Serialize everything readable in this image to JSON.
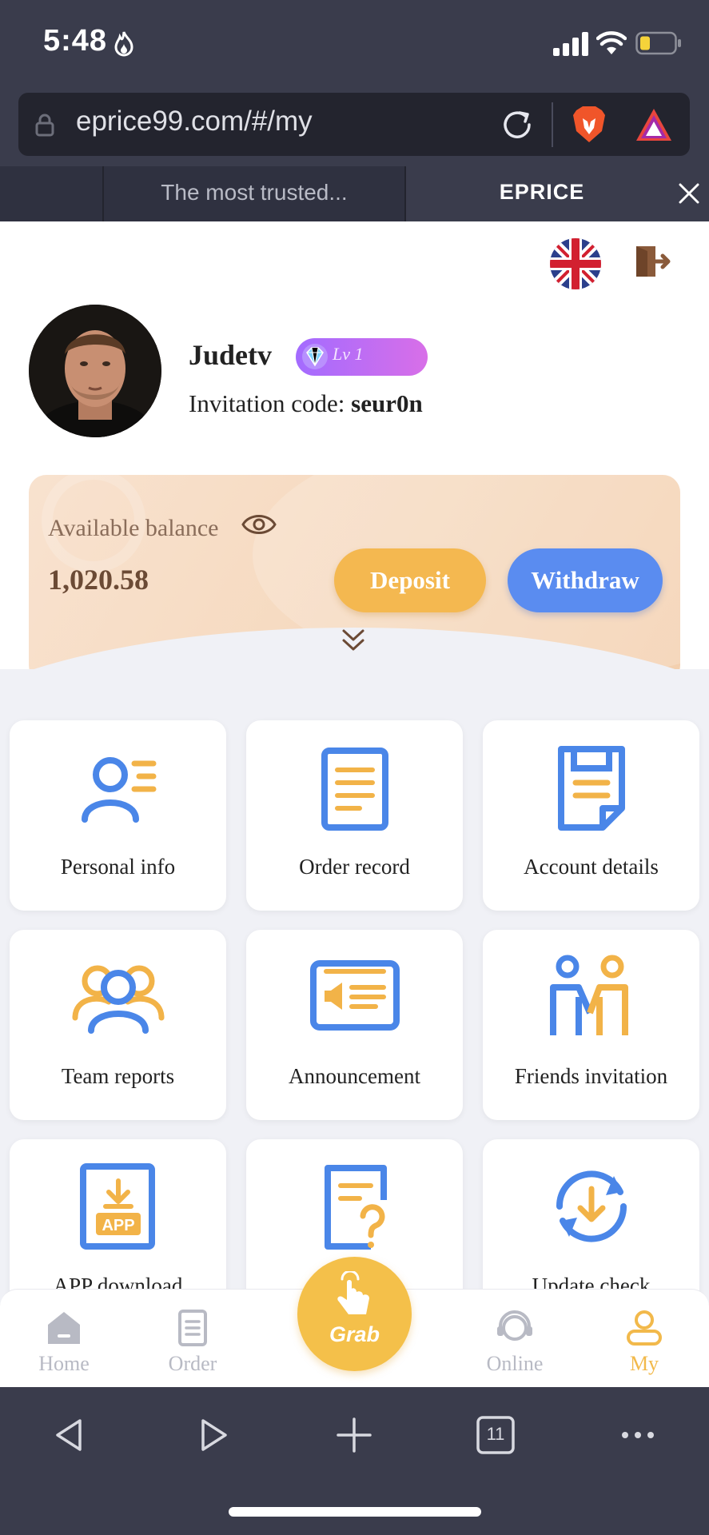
{
  "status_bar": {
    "time": "5:48"
  },
  "browser": {
    "url": "eprice99.com/#/my",
    "tabs": [
      {
        "label": "The most trusted..."
      },
      {
        "label": "EPRICE"
      }
    ],
    "tab_count": "11"
  },
  "profile": {
    "username": "Judetv",
    "level": "Lv 1",
    "invite_label": "Invitation code: ",
    "invite_code": "seur0n"
  },
  "balance": {
    "label": "Available balance",
    "value": "1,020.58",
    "deposit_label": "Deposit",
    "withdraw_label": "Withdraw"
  },
  "menu": [
    {
      "label": "Personal info",
      "icon": "personal-info-icon"
    },
    {
      "label": "Order record",
      "icon": "order-record-icon"
    },
    {
      "label": "Account details",
      "icon": "account-details-icon"
    },
    {
      "label": "Team reports",
      "icon": "team-reports-icon"
    },
    {
      "label": "Announcement",
      "icon": "announcement-icon"
    },
    {
      "label": "Friends invitation",
      "icon": "friends-invitation-icon"
    },
    {
      "label": "APP download",
      "icon": "app-download-icon"
    },
    {
      "label": "",
      "icon": "faq-icon"
    },
    {
      "label": "Update check",
      "icon": "update-check-icon"
    }
  ],
  "nav": {
    "home": "Home",
    "order": "Order",
    "grab": "Grab",
    "online": "Online",
    "my": "My"
  },
  "colors": {
    "accent_orange": "#f4b850",
    "accent_blue": "#5a8cf0",
    "icon_blue": "#4a86e8",
    "icon_orange": "#f2b348",
    "chrome_dark": "#3a3c4c"
  }
}
